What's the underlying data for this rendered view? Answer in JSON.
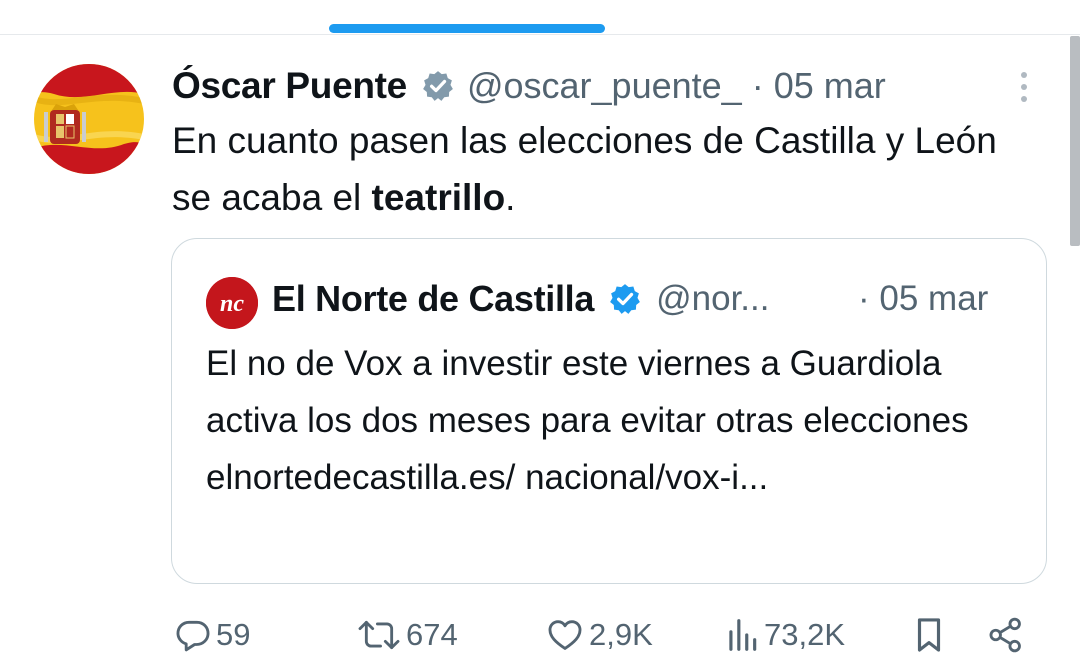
{
  "tweet": {
    "author_name": "Óscar Puente",
    "handle": "@oscar_puente_",
    "separator": "·",
    "date": "05 mar",
    "text_prefix": "En cuanto pasen las elecciones de Castilla y León se acaba el ",
    "text_bold": "teatrillo",
    "text_suffix": "."
  },
  "quote": {
    "avatar_text": "nc",
    "author_name": "El Norte de Castilla",
    "handle": "@nor...",
    "date": "· 05 mar",
    "text": "El no de Vox a investir este viernes a Guardiola activa los dos meses para evitar otras elecciones elnortedecastilla.es/ nacional/vox-i..."
  },
  "actions": {
    "replies": "59",
    "retweets": "674",
    "likes": "2,9K",
    "views": "73,2K"
  },
  "icons": [
    "reply-icon",
    "retweet-icon",
    "like-icon",
    "views-icon",
    "bookmark-icon",
    "share-icon",
    "verified-icon",
    "more-icon"
  ],
  "colors": {
    "accent": "#1d9bf0",
    "secondary_text": "#536471",
    "border": "#cfd9de",
    "norte_red": "#c4161c"
  }
}
